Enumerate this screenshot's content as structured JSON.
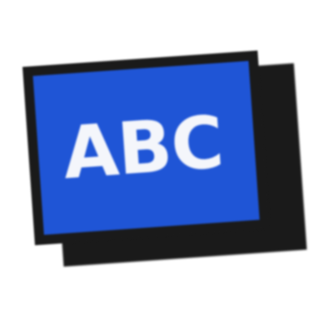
{
  "icon": {
    "name": "text-abc-icon",
    "label": "ABC",
    "colors": {
      "panel": "#1f55d6",
      "border": "#1a1a1a",
      "shadow_card": "#1a1a1a",
      "text": "#f4f6fb",
      "background": "#ffffff"
    }
  }
}
